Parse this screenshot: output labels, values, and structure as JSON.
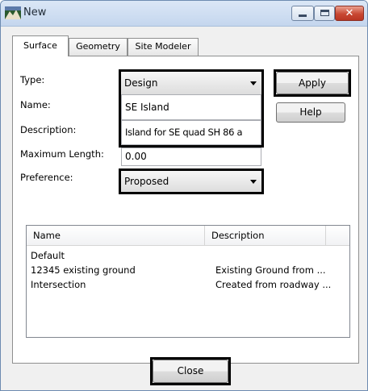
{
  "window": {
    "title": "New"
  },
  "tabs": [
    {
      "label": "Surface",
      "active": true
    },
    {
      "label": "Geometry",
      "active": false
    },
    {
      "label": "Site Modeler",
      "active": false
    }
  ],
  "form": {
    "type_label": "Type:",
    "type_value": "Design",
    "name_label": "Name:",
    "name_value": "SE Island",
    "description_label": "Description:",
    "description_value": "Island for SE quad SH 86 a",
    "max_length_label": "Maximum Length:",
    "max_length_value": "0.00",
    "preference_label": "Preference:",
    "preference_value": "Proposed"
  },
  "buttons": {
    "apply": "Apply",
    "help": "Help",
    "close": "Close"
  },
  "list": {
    "columns": [
      "Name",
      "Description"
    ],
    "rows": [
      {
        "name": "Default",
        "description": ""
      },
      {
        "name": "12345 existing ground",
        "description": "Existing Ground from ..."
      },
      {
        "name": "Intersection",
        "description": "Created from roadway ..."
      }
    ]
  },
  "icons": {
    "app": "microstation-icon",
    "minimize": "minimize-icon",
    "maximize": "maximize-icon",
    "close": "close-icon",
    "dropdown": "chevron-down-icon"
  },
  "colors": {
    "highlight_border": "#000000",
    "close_button": "#c84833",
    "titlebar": "#c4d6ee"
  }
}
